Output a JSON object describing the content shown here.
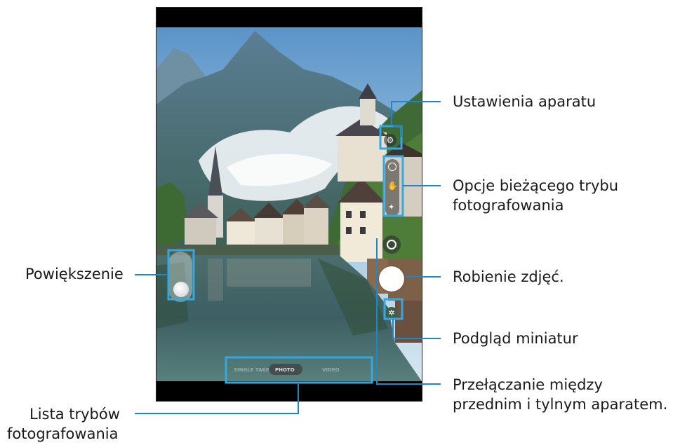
{
  "camera": {
    "modes": [
      "SINGLE TAKE",
      "PHOTO",
      "VIDEO"
    ],
    "current_mode_index": 1
  },
  "labels": {
    "settings": "Ustawienia aparatu",
    "current_mode_options_line1": "Opcje bieżącego trybu",
    "current_mode_options_line2": "fotografowania",
    "shutter": "Robienie zdjęć.",
    "thumbnail": "Podgląd miniatur",
    "switch_camera_line1": "Przełączanie między",
    "switch_camera_line2": "przednim i tylnym aparatem.",
    "zoom": "Powiększenie",
    "mode_list_line1": "Lista trybów",
    "mode_list_line2": "fotografowania"
  },
  "icons": {
    "settings": "gear-icon",
    "timer": "timer-icon",
    "palm": "palm-icon",
    "filter": "sparkle-icon",
    "switch": "switch-camera-icon",
    "thumbnail": "thumbnail-icon"
  },
  "colors": {
    "callout": "#1e87c9",
    "highlight": "#34a8e0"
  }
}
